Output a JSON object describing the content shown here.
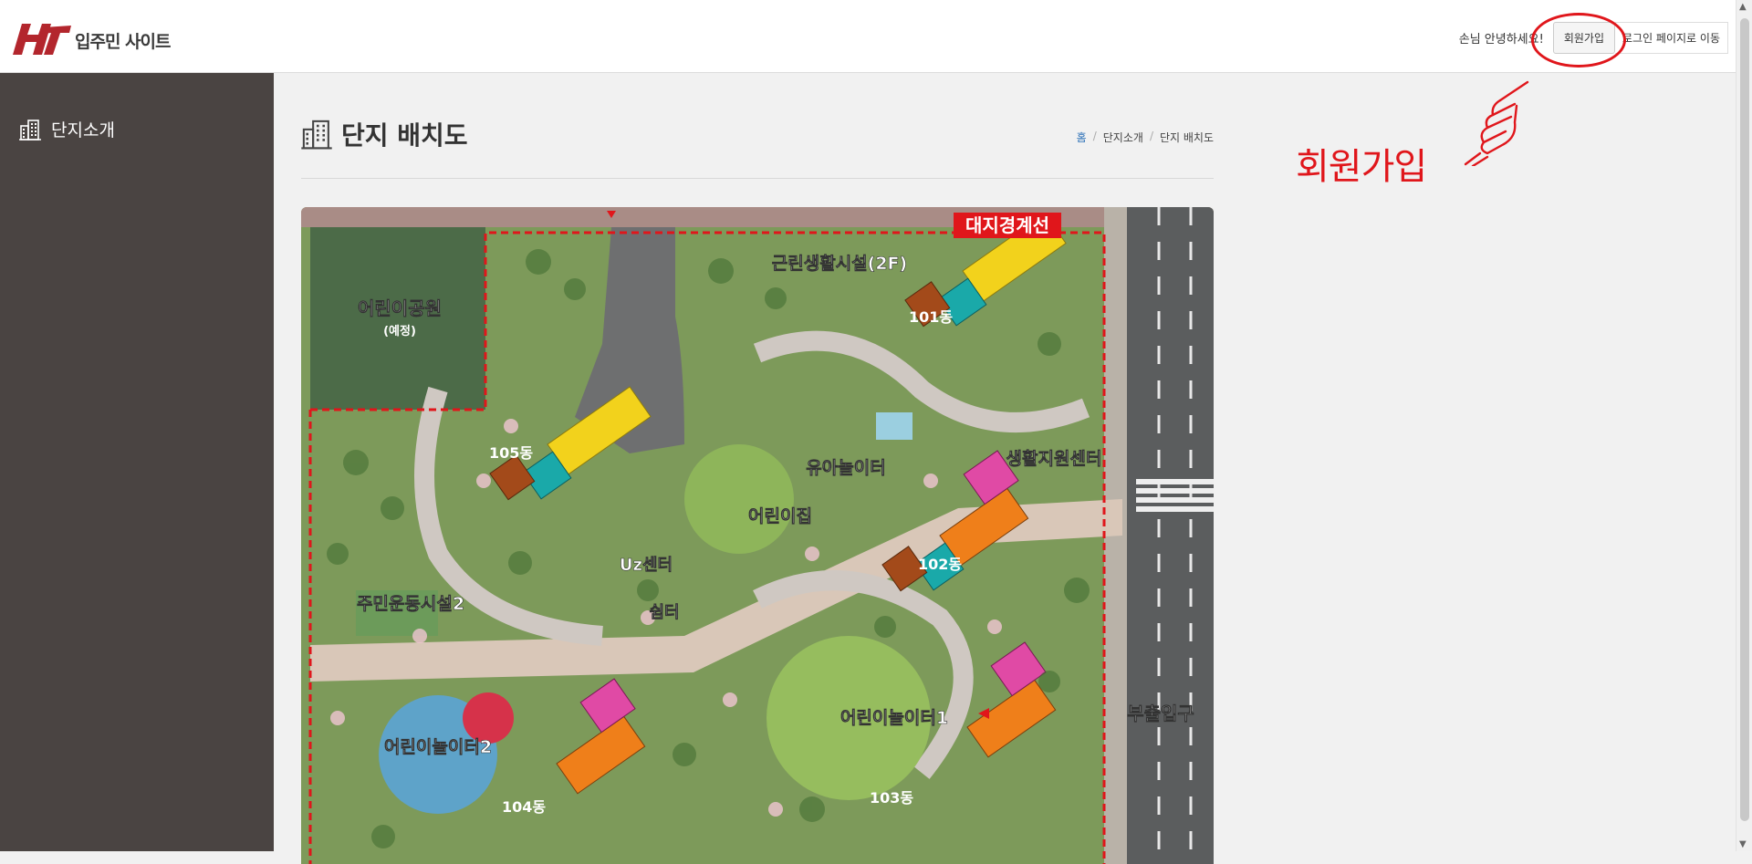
{
  "header": {
    "logo_text": "입주민 사이트",
    "greeting": "손님 안녕하세요!",
    "signup_label": "회원가입",
    "login_label": "로그인 페이지로 이동"
  },
  "sidebar": {
    "items": [
      {
        "label": "단지소개",
        "icon": "building-icon"
      }
    ]
  },
  "page": {
    "title": "단지 배치도",
    "breadcrumb": [
      "홈",
      "단지소개",
      "단지 배치도"
    ]
  },
  "annotation": {
    "text": "회원가입"
  },
  "map": {
    "labels": {
      "boundary": "대지경계선",
      "commercial": "근린생활시설(2F)",
      "playground_park": "어린이공원",
      "planned": "(예정)",
      "b101": "101동",
      "b102": "102동",
      "b103": "103동",
      "b104": "104동",
      "b105": "105동",
      "toddler_play": "유아놀이터",
      "life_support": "생활지원센터",
      "daycare": "어린이집",
      "uz_center": "Uz센터",
      "pavilion": "쉼터",
      "sports2": "주민운동시설2",
      "kids_play1": "어린이놀이터1",
      "kids_play2": "어린이놀이터2",
      "side_entrance": "부출입구"
    }
  },
  "colors": {
    "sidebar_bg": "#4a4442",
    "annotation_red": "#e0161b",
    "page_bg": "#f1f1f1",
    "building_yellow": "#f2d21c",
    "building_teal": "#1aa9a9",
    "building_brown": "#a34a1a",
    "building_pink": "#e04aa5",
    "building_orange": "#ef7f1a"
  }
}
